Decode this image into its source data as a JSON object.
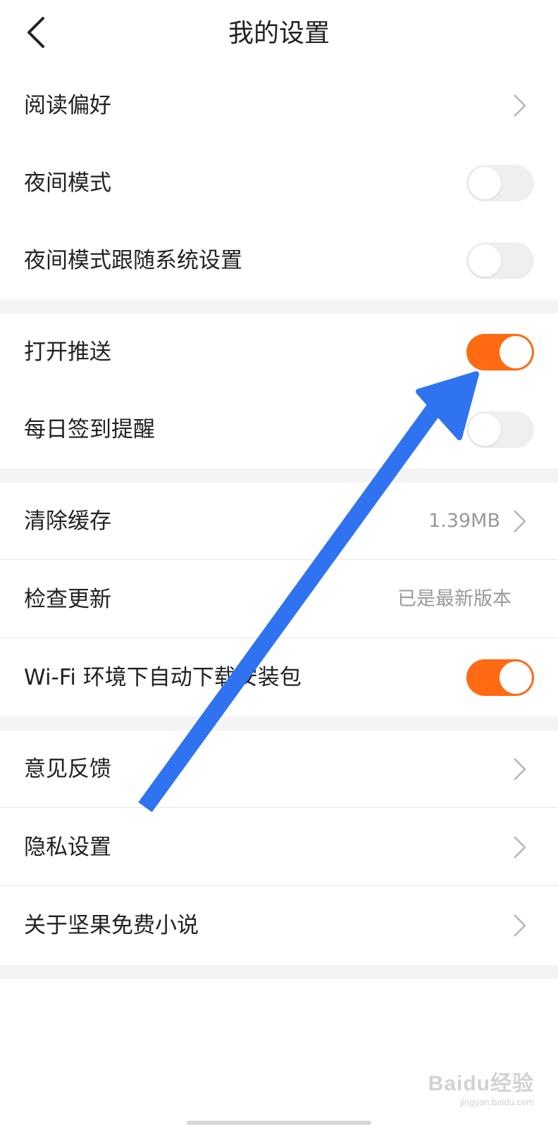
{
  "header": {
    "title": "我的设置",
    "back_icon": "chevron-left-icon"
  },
  "section1": {
    "reading_pref": "阅读偏好",
    "night_mode": "夜间模式",
    "night_mode_on": false,
    "night_follow_system": "夜间模式跟随系统设置",
    "night_follow_system_on": false
  },
  "section2": {
    "push": "打开推送",
    "push_on": true,
    "checkin_reminder": "每日签到提醒",
    "checkin_reminder_on": false
  },
  "section3": {
    "clear_cache": "清除缓存",
    "cache_size": "1.39MB",
    "check_update": "检查更新",
    "update_status": "已是最新版本",
    "wifi_download": "Wi-Fi 环境下自动下载安装包",
    "wifi_download_on": true
  },
  "section4": {
    "feedback": "意见反馈",
    "privacy": "隐私设置",
    "about": "关于坚果免费小说"
  },
  "watermark": {
    "main": "Baidu经验",
    "sub": "jingyan.baidu.com"
  },
  "colors": {
    "toggle_on": "#ff6a12",
    "annotation_arrow": "#2f73f0"
  }
}
